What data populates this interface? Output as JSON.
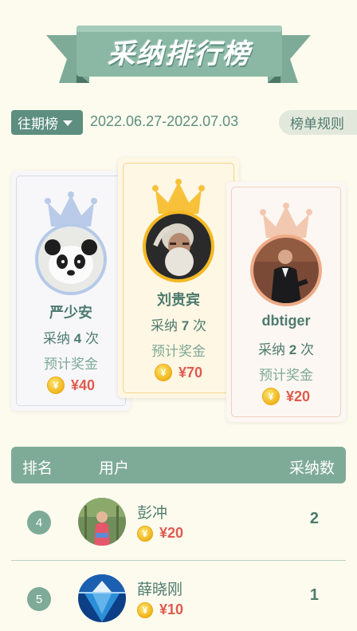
{
  "banner": {
    "title": "采纳排行榜"
  },
  "period": {
    "button_label": "往期榜",
    "date_range": "2022.06.27-2022.07.03",
    "rules_label": "榜单规则"
  },
  "podium": [
    {
      "place": 2,
      "name": "严少安",
      "adopt_prefix": "采纳",
      "adopt_count": "4",
      "adopt_suffix": "次",
      "prize_label": "预计奖金",
      "prize": "¥40",
      "avatar": "panda-avatar",
      "accent": "#b5c9e8"
    },
    {
      "place": 1,
      "name": "刘贵宾",
      "adopt_prefix": "采纳",
      "adopt_count": "7",
      "adopt_suffix": "次",
      "prize_label": "预计奖金",
      "prize": "¥70",
      "avatar": "bearded-man-avatar",
      "accent": "#f5b820"
    },
    {
      "place": 3,
      "name": "dbtiger",
      "adopt_prefix": "采纳",
      "adopt_count": "2",
      "adopt_suffix": "次",
      "prize_label": "预计奖金",
      "prize": "¥20",
      "avatar": "man-in-suit-avatar",
      "accent": "#eeaa86"
    }
  ],
  "table": {
    "headers": {
      "rank": "排名",
      "user": "用户",
      "count": "采纳数"
    },
    "rows": [
      {
        "rank": "4",
        "name": "彭冲",
        "prize": "¥20",
        "count": "2",
        "avatar": "child-avatar"
      },
      {
        "rank": "5",
        "name": "薛晓刚",
        "prize": "¥10",
        "count": "1",
        "avatar": "iceberg-avatar"
      }
    ]
  },
  "colors": {
    "background": "#fdfbee",
    "primary": "#5d8e7f",
    "header": "#7eab98",
    "prize": "#e05a4e",
    "gold": "#f5b820"
  }
}
